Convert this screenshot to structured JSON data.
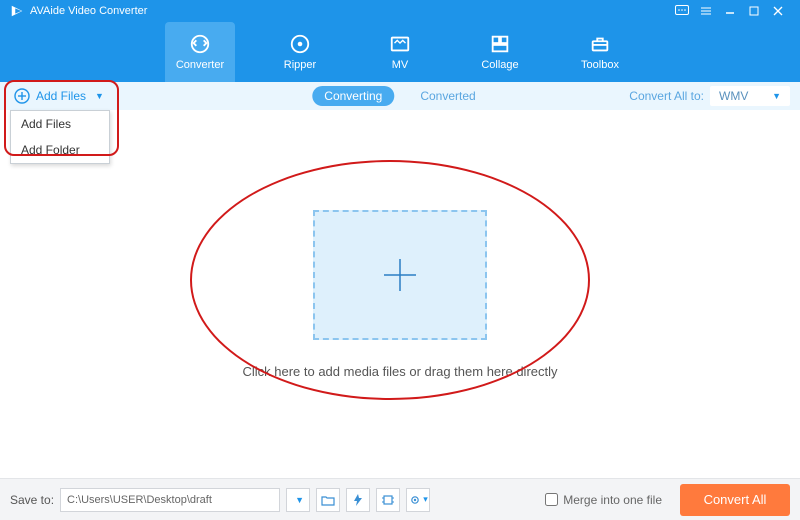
{
  "titlebar": {
    "title": "AVAide Video Converter"
  },
  "topnav": {
    "items": [
      {
        "label": "Converter"
      },
      {
        "label": "Ripper"
      },
      {
        "label": "MV"
      },
      {
        "label": "Collage"
      },
      {
        "label": "Toolbox"
      }
    ]
  },
  "subbar": {
    "add_files": "Add Files",
    "tabs": {
      "converting": "Converting",
      "converted": "Converted"
    },
    "convert_all_label": "Convert All to:",
    "convert_all_value": "WMV"
  },
  "dropdown": {
    "add_files": "Add Files",
    "add_folder": "Add Folder"
  },
  "workspace": {
    "drop_text": "Click here to add media files or drag them here directly"
  },
  "bottombar": {
    "save_to_label": "Save to:",
    "path": "C:\\Users\\USER\\Desktop\\draft",
    "merge_label": "Merge into one file",
    "convert_all_btn": "Convert All"
  }
}
